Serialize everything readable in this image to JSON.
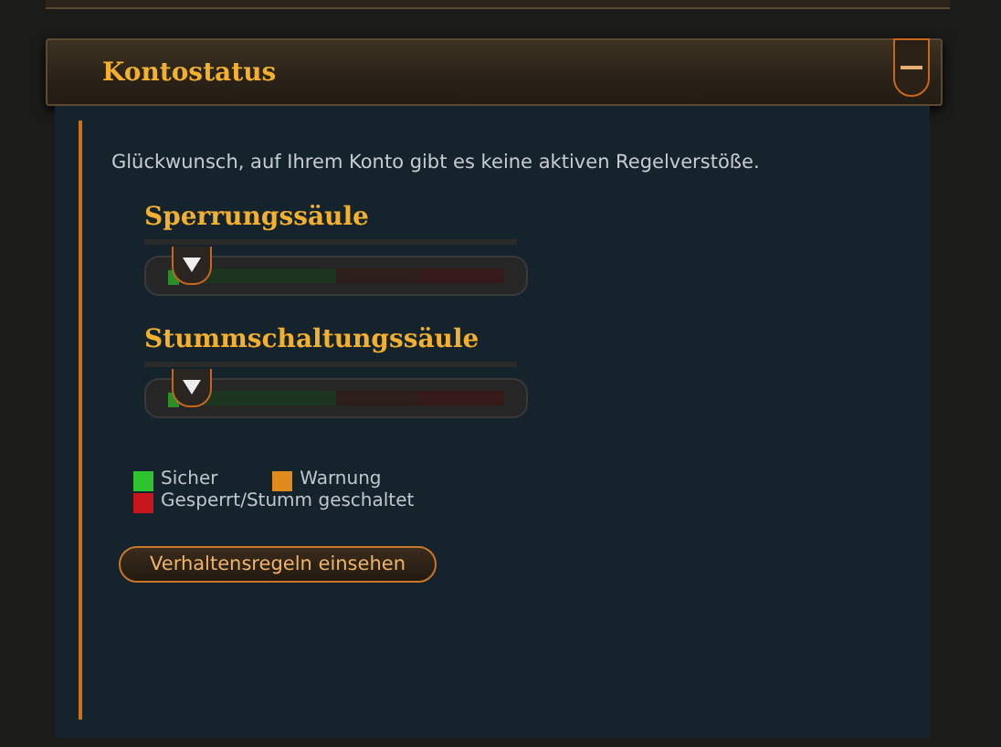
{
  "panel": {
    "title": "Kontostatus",
    "expanded": true
  },
  "message": "Glückwunsch, auf Ihrem Konto gibt es keine aktiven Regelverstöße.",
  "meters": [
    {
      "title": "Sperrungssäule",
      "level": 0.03
    },
    {
      "title": "Stummschaltungssäule",
      "level": 0.03
    }
  ],
  "legend": [
    {
      "label": "Sicher",
      "color": "#2fc42f"
    },
    {
      "label": "Warnung",
      "color": "#e08a1c"
    },
    {
      "label": "Gesperrt/Stumm geschaltet",
      "color": "#c8161c"
    }
  ],
  "button": "Verhaltensregeln einsehen"
}
